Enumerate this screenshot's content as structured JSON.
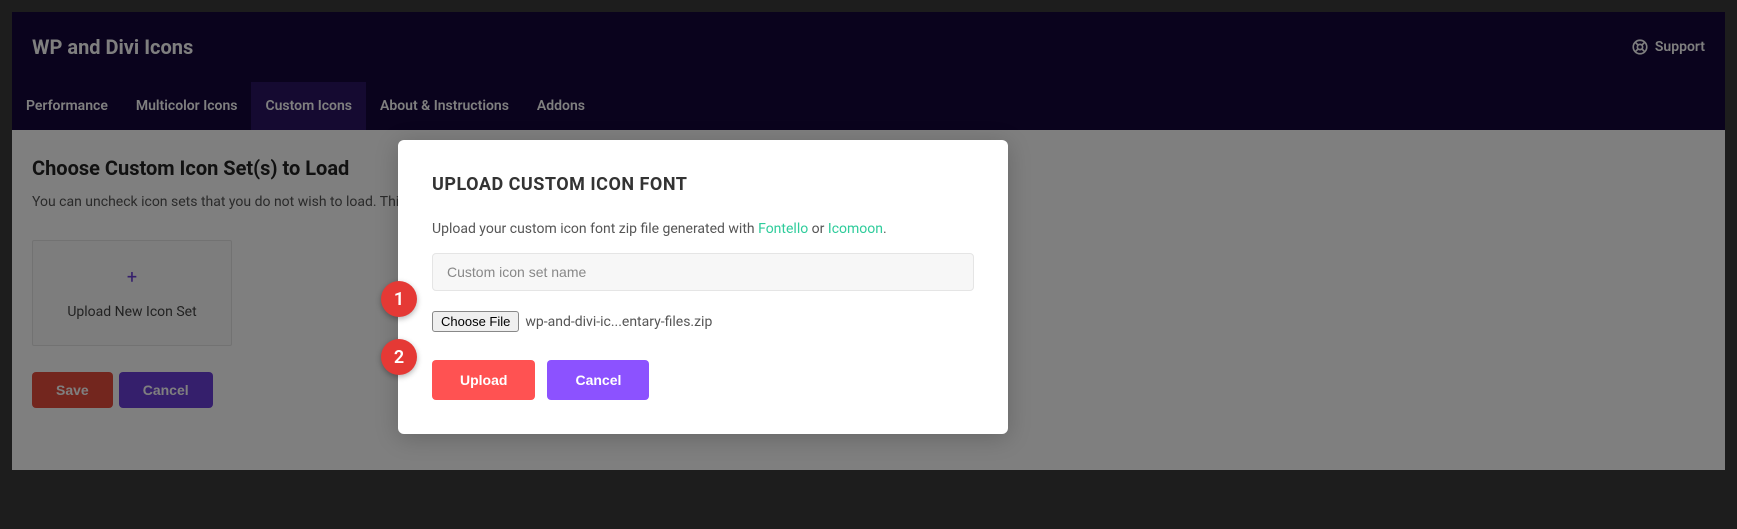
{
  "header": {
    "title": "WP and Divi Icons",
    "support_label": "Support"
  },
  "tabs": [
    {
      "label": "Performance"
    },
    {
      "label": "Multicolor Icons"
    },
    {
      "label": "Custom Icons"
    },
    {
      "label": "About & Instructions"
    },
    {
      "label": "Addons"
    }
  ],
  "content": {
    "title": "Choose Custom Icon Set(s) to Load",
    "desc": "You can uncheck icon sets that you do not wish to load. This ca",
    "upload_tile_label": "Upload New Icon Set",
    "save_label": "Save",
    "cancel_label": "Cancel"
  },
  "modal": {
    "title": "UPLOAD CUSTOM ICON FONT",
    "desc_prefix": "Upload your custom icon font zip file generated with ",
    "link1": "Fontello",
    "desc_or": " or ",
    "link2": "Icomoon",
    "desc_suffix": ".",
    "input_placeholder": "Custom icon set name",
    "choose_file_label": "Choose File",
    "file_name": "wp-and-divi-ic...entary-files.zip",
    "upload_label": "Upload",
    "cancel_label": "Cancel"
  },
  "annotations": {
    "a1": "1",
    "a2": "2"
  }
}
